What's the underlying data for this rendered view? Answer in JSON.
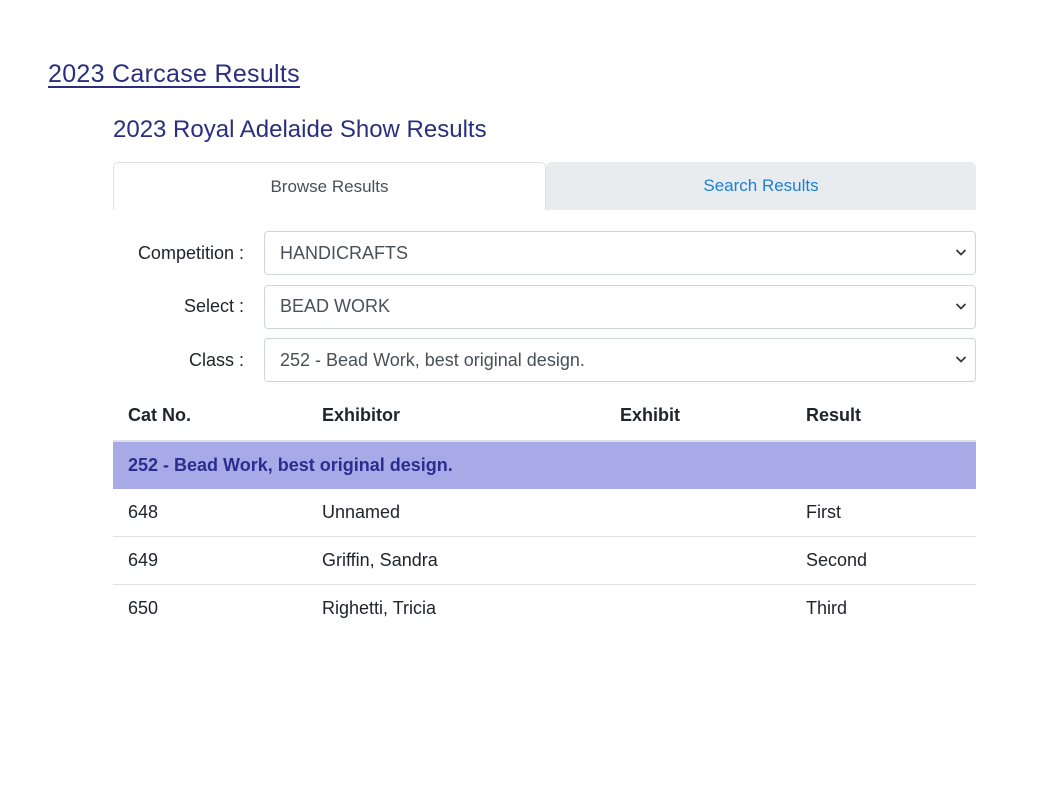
{
  "page_link": "2023 Carcase Results",
  "section_title": "2023 Royal Adelaide Show Results",
  "tabs": [
    {
      "label": "Browse Results",
      "active": true
    },
    {
      "label": "Search Results",
      "active": false
    }
  ],
  "form": {
    "competition_label": "Competition :",
    "competition_value": "HANDICRAFTS",
    "select_label": "Select :",
    "select_value": "BEAD WORK",
    "class_label": "Class :",
    "class_value": "252 - Bead Work, best original design."
  },
  "table": {
    "headers": [
      "Cat No.",
      "Exhibitor",
      "Exhibit",
      "Result"
    ],
    "group_title": "252 - Bead Work, best original design.",
    "rows": [
      {
        "cat_no": "648",
        "exhibitor": "Unnamed",
        "exhibit": "",
        "result": "First"
      },
      {
        "cat_no": "649",
        "exhibitor": "Griffin, Sandra",
        "exhibit": "",
        "result": "Second"
      },
      {
        "cat_no": "650",
        "exhibitor": "Righetti, Tricia",
        "exhibit": "",
        "result": "Third"
      }
    ]
  },
  "colors": {
    "heading": "#2a2e7f",
    "link_tab": "#1a7fd6",
    "group_row_bg": "#a8aae8"
  }
}
